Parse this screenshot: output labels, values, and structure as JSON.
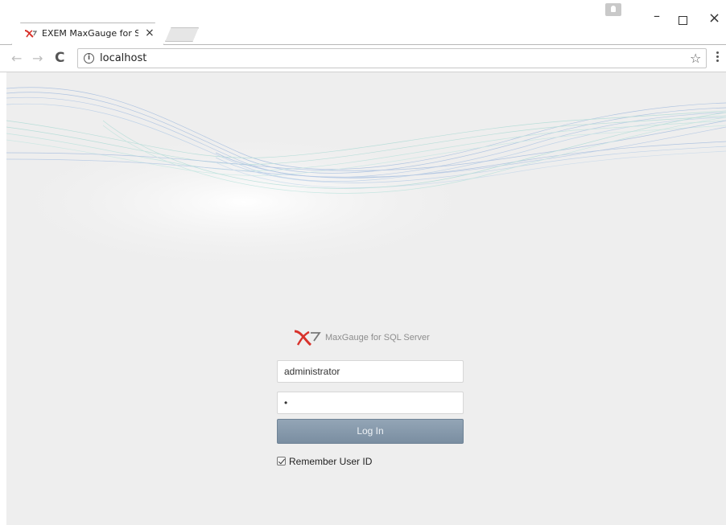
{
  "browser": {
    "tab_title": "EXEM MaxGauge for SQL",
    "tab_close": "×",
    "url": "localhost",
    "info_glyph": "i",
    "icons": {
      "back": "back-arrow-icon",
      "forward": "forward-arrow-icon",
      "reload": "reload-icon",
      "bookmark": "star-icon",
      "menu": "kebab-menu-icon"
    }
  },
  "window_controls": {
    "minimize": "–",
    "close": "×"
  },
  "login": {
    "brand_name": "MaxGauge for SQL Server",
    "username_value": "administrator",
    "password_value": "•",
    "login_button": "Log In",
    "remember_label": "Remember User ID",
    "remember_checked": true
  },
  "colors": {
    "page_background": "#eeeeee",
    "button": "#8597aa",
    "logo_red": "#d8322b",
    "wave_blue": "#7ea3d6",
    "wave_teal": "#8fd1c9"
  }
}
